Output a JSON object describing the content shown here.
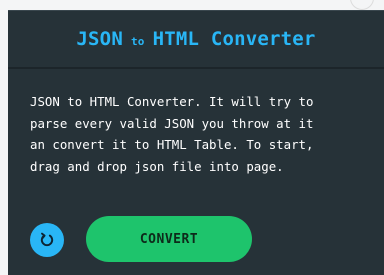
{
  "header": {
    "title_part1": "JSON",
    "title_connector": "to",
    "title_part2": "HTML Converter"
  },
  "description": "JSON to HTML Converter. It will try to\nparse every valid JSON you throw at it\nan convert it to HTML Table. To start,\ndrag and drop json file into page.",
  "buttons": {
    "refresh_icon": "refresh-icon",
    "convert_label": "CONVERT"
  },
  "colors": {
    "panel_bg": "#263238",
    "accent_blue": "#29b6f6",
    "accent_green": "#1ec46c",
    "text": "#ffffff"
  }
}
